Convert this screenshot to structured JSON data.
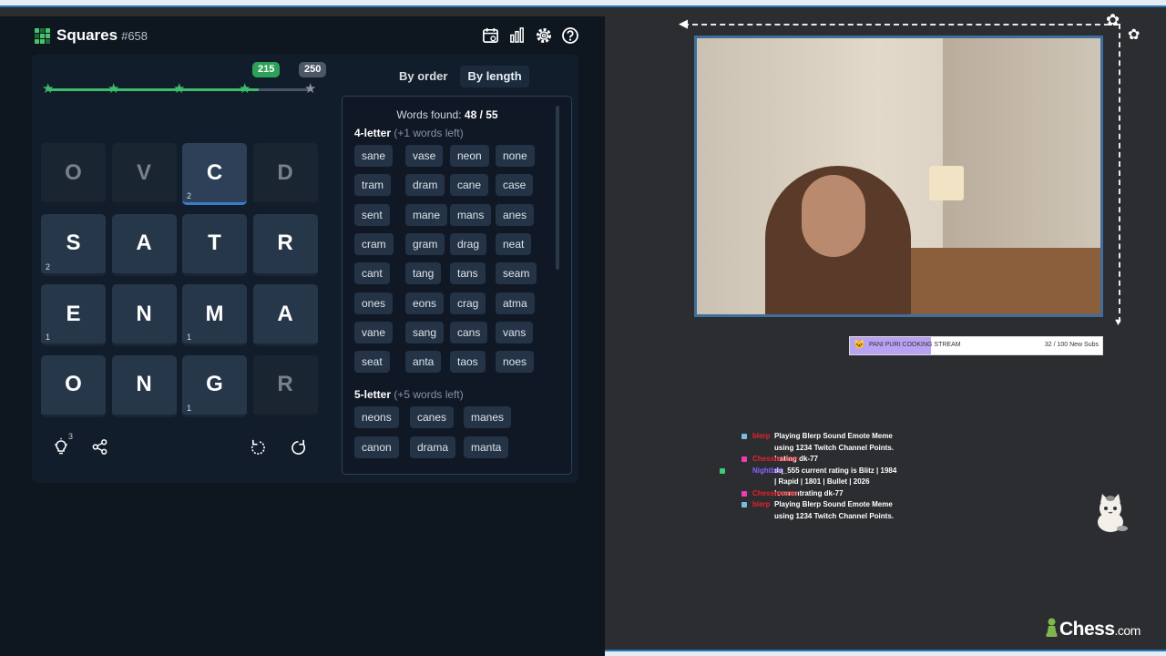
{
  "game": {
    "title": "Squares",
    "number": "#658",
    "progress": {
      "milestone_current": "215",
      "milestone_max": "250",
      "fraction": 0.8
    },
    "tiles": [
      {
        "letter": "O",
        "count": "",
        "state": "dim"
      },
      {
        "letter": "V",
        "count": "",
        "state": "dim"
      },
      {
        "letter": "C",
        "count": "2",
        "state": "sel"
      },
      {
        "letter": "D",
        "count": "",
        "state": "dim"
      },
      {
        "letter": "S",
        "count": "2",
        "state": "on"
      },
      {
        "letter": "A",
        "count": "",
        "state": "on"
      },
      {
        "letter": "T",
        "count": "",
        "state": "on"
      },
      {
        "letter": "R",
        "count": "",
        "state": "on"
      },
      {
        "letter": "E",
        "count": "1",
        "state": "on"
      },
      {
        "letter": "N",
        "count": "",
        "state": "on"
      },
      {
        "letter": "M",
        "count": "1",
        "state": "on"
      },
      {
        "letter": "A",
        "count": "",
        "state": "on"
      },
      {
        "letter": "O",
        "count": "",
        "state": "on"
      },
      {
        "letter": "N",
        "count": "",
        "state": "on"
      },
      {
        "letter": "G",
        "count": "1",
        "state": "on"
      },
      {
        "letter": "R",
        "count": "",
        "state": "dim"
      }
    ],
    "hint_count": "3",
    "tabs": {
      "by_order": "By order",
      "by_length": "By length"
    },
    "words_found_label": "Words found:",
    "words_found": "48 / 55",
    "sections": [
      {
        "title": "4-letter",
        "left": "(+1 words left)",
        "words": [
          "sane",
          "vase",
          "neon",
          "none",
          "tram",
          "dram",
          "cane",
          "case",
          "sent",
          "mane",
          "mans",
          "anes",
          "cram",
          "gram",
          "drag",
          "neat",
          "cant",
          "tang",
          "tans",
          "seam",
          "ones",
          "eons",
          "crag",
          "atma",
          "vane",
          "sang",
          "cans",
          "vans",
          "seat",
          "anta",
          "taos",
          "noes"
        ]
      },
      {
        "title": "5-letter",
        "left": "(+5 words left)",
        "words": [
          "neons",
          "canes",
          "manes",
          "canon",
          "drama",
          "manta"
        ]
      }
    ]
  },
  "stream": {
    "sub_goal_left": "PANI PURI COOKING STREAM",
    "sub_goal_right": "32 / 100 New Subs",
    "chat": [
      {
        "name": "blerp",
        "name_color": "#e8242a",
        "badge": "#7cbbe0",
        "text": "Playing Blerp Sound Emote Meme"
      },
      {
        "name": "",
        "name_color": "#fff",
        "badge": "",
        "text": "using 1234 Twitch Channel Points."
      },
      {
        "name": "Chessmaster",
        "name_color": "#e8242a",
        "badge": "#f23bb0",
        "text": "!rating dk-77"
      },
      {
        "name": "Nightbot",
        "name_color": "#8a64ff",
        "badge": "#3bcf73",
        "text": "dq_555 current rating is Blitz | 1984"
      },
      {
        "name": "",
        "name_color": "#fff",
        "badge": "",
        "text": "| Rapid | 1801 | Bullet | 2026"
      },
      {
        "name": "Chessmaster",
        "name_color": "#e8242a",
        "badge": "#f23bb0",
        "text": "!currentrating dk-77"
      },
      {
        "name": "blerp",
        "name_color": "#e8242a",
        "badge": "#7cbbe0",
        "text": "Playing Blerp Sound Emote Meme"
      },
      {
        "name": "",
        "name_color": "#fff",
        "badge": "",
        "text": "using 1234 Twitch Channel Points."
      }
    ],
    "brand_main": "Chess",
    "brand_suffix": ".com"
  },
  "icons": [
    "calendar-icon",
    "stats-icon",
    "gear-icon",
    "help-icon",
    "lightbulb-icon",
    "share-icon",
    "undo-icon",
    "redo-icon",
    "star-icon"
  ],
  "colors": {
    "accent_green": "#3dbd6b",
    "panel_bg": "#111d2a",
    "tile_bg": "#27374a",
    "stream_bg": "#2b2d31",
    "frame_blue": "#3f6e9c"
  }
}
